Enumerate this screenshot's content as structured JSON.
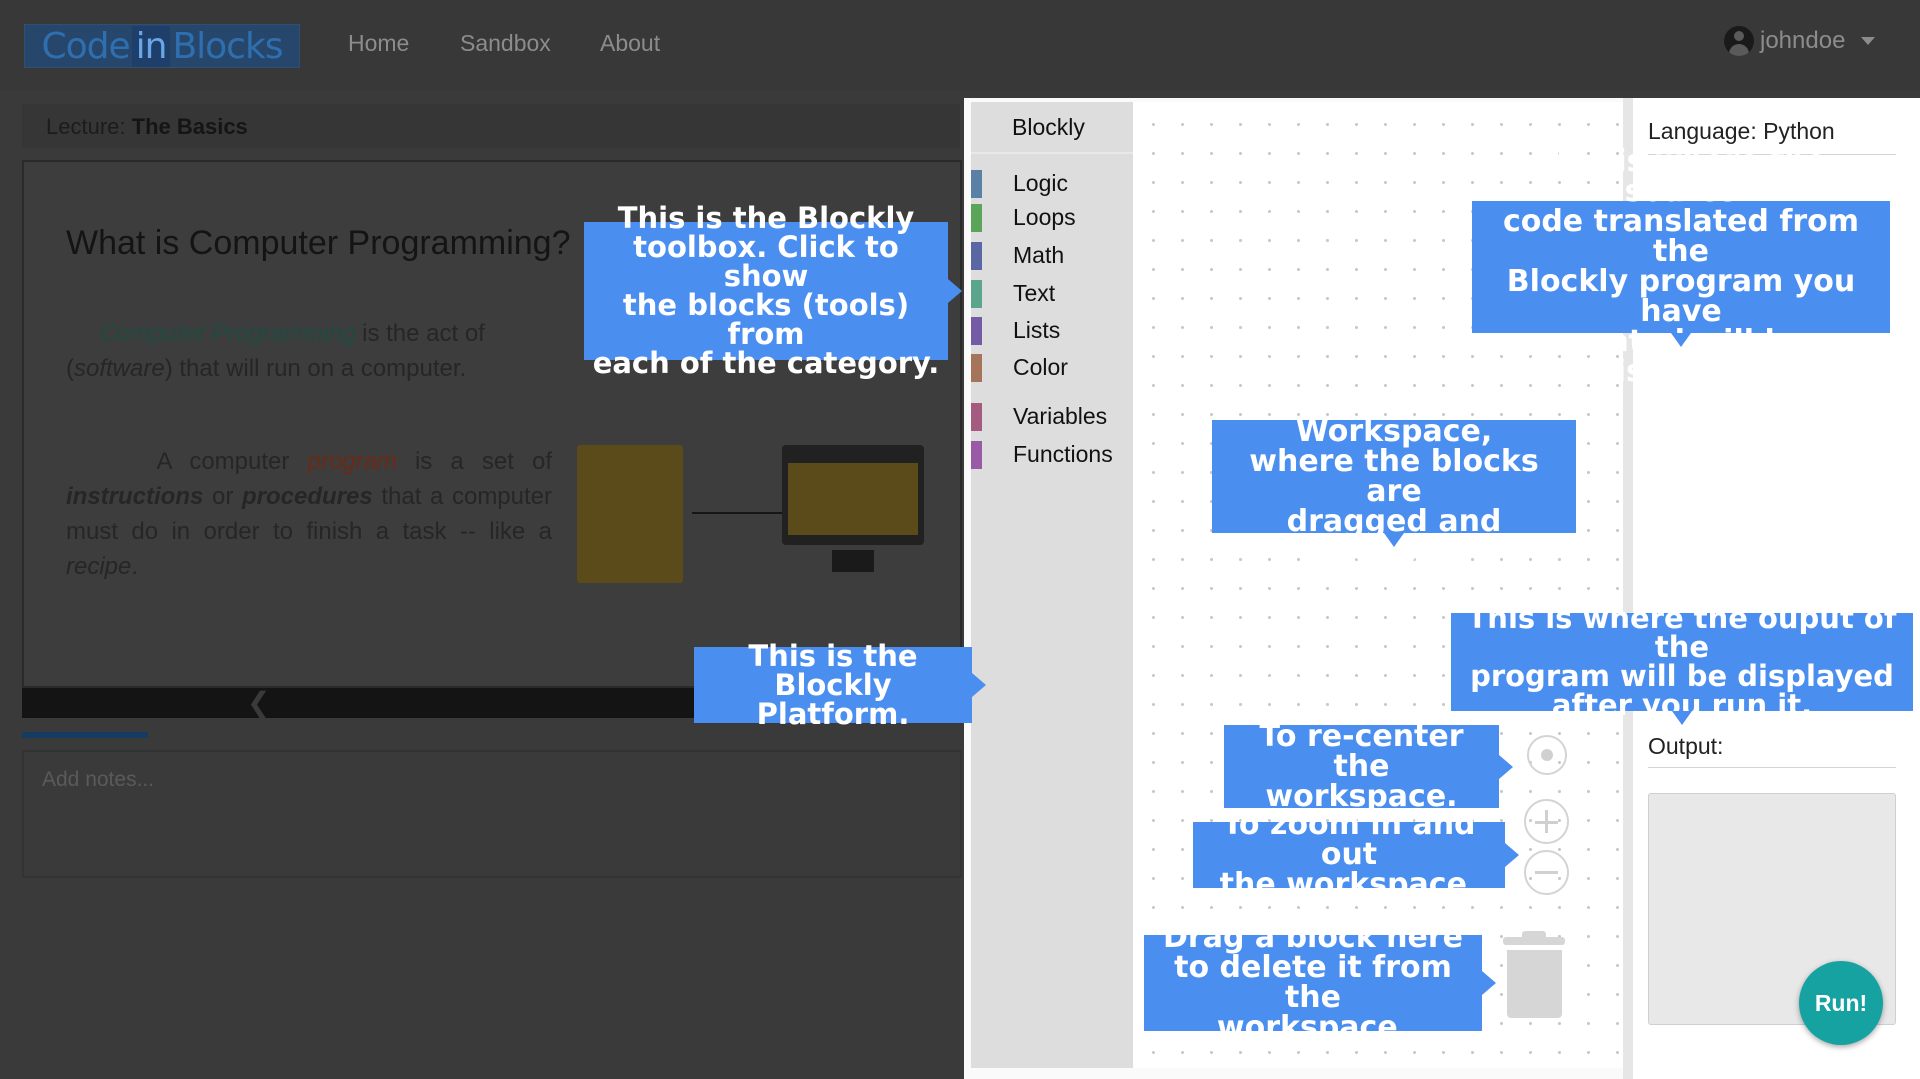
{
  "nav": {
    "logo_left": "Code",
    "logo_mid": "in",
    "logo_right": "Blocks",
    "links": [
      "Home",
      "Sandbox",
      "About"
    ],
    "user": "johndoe"
  },
  "lecture": {
    "prefix": "Lecture:",
    "name": "The Basics",
    "title": "What is Computer Programming?",
    "p1_term": "Computer Programming",
    "p1_rest": "is the act of",
    "p1_line2_word": "software",
    "p1_line2_rest": "that will run on a computer.",
    "p2_a": "A computer",
    "p2_term": "program",
    "p2_b": "is a set of",
    "p2_instr": "instructions",
    "p2_or": "or",
    "p2_proc": "procedures",
    "p2_c": "that a computer must do in order to finish a task -- like a",
    "p2_recipe": "recipe",
    "notes_placeholder": "Add notes..."
  },
  "toolbox": {
    "title": "Blockly",
    "categories": [
      {
        "label": "Logic",
        "color": "#5b80a5"
      },
      {
        "label": "Loops",
        "color": "#5ba55b"
      },
      {
        "label": "Math",
        "color": "#5b67a5"
      },
      {
        "label": "Text",
        "color": "#5ba58c"
      },
      {
        "label": "Lists",
        "color": "#745ba5"
      },
      {
        "label": "Color",
        "color": "#a5745b"
      },
      {
        "label": "Variables",
        "color": "#a55b80"
      },
      {
        "label": "Functions",
        "color": "#995ba5"
      }
    ]
  },
  "code_panel": {
    "language_label": "Language: Python",
    "output_label": "Output:",
    "run_label": "Run!"
  },
  "tooltips": {
    "toolbox": [
      "This is the Blockly",
      "toolbox. Click to show",
      "the blocks (tools) from",
      "each of the category."
    ],
    "platform": [
      "This is the",
      "Blockly Platform."
    ],
    "workspace": [
      "This is the Workspace,",
      "where the blocks are",
      "dragged and dropped."
    ],
    "source": [
      "This is where the source",
      "code translated from the",
      "Blockly program you have",
      "created will be displayed."
    ],
    "output": [
      "This is where the ouput of the",
      "program will be displayed",
      "after you run it."
    ],
    "recenter": [
      "To re-center the",
      "workspace."
    ],
    "zoom": [
      "To zoom in and out",
      "the workspace."
    ],
    "trash": [
      "Drag a block here",
      "to delete it from the",
      "workspace."
    ]
  }
}
